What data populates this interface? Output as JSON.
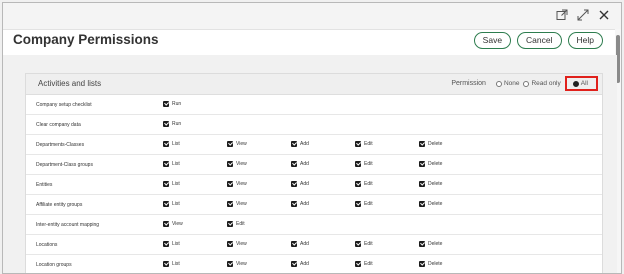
{
  "window": {
    "icons": [
      "open-in-new-icon",
      "expand-icon",
      "close-icon"
    ]
  },
  "header": {
    "title": "Company Permissions",
    "buttons": {
      "save": "Save",
      "cancel": "Cancel",
      "help": "Help"
    }
  },
  "section": {
    "title": "Activities and lists",
    "permission_label": "Permission",
    "options": {
      "none": "None",
      "readonly": "Read only",
      "all": "All"
    },
    "selected": "All"
  },
  "rows": [
    {
      "label": "Company setup checklist",
      "perms": [
        "Run"
      ]
    },
    {
      "label": "Clear company data",
      "perms": [
        "Run"
      ]
    },
    {
      "label": "Departments-Classes",
      "perms": [
        "List",
        "View",
        "Add",
        "Edit",
        "Delete"
      ]
    },
    {
      "label": "Department-Class groups",
      "perms": [
        "List",
        "View",
        "Add",
        "Edit",
        "Delete"
      ]
    },
    {
      "label": "Entities",
      "perms": [
        "List",
        "View",
        "Add",
        "Edit",
        "Delete"
      ]
    },
    {
      "label": "Affiliate entity groups",
      "perms": [
        "List",
        "View",
        "Add",
        "Edit",
        "Delete"
      ]
    },
    {
      "label": "Inter-entity account mapping",
      "perms": [
        "View",
        "Edit"
      ]
    },
    {
      "label": "Locations",
      "perms": [
        "List",
        "View",
        "Add",
        "Edit",
        "Delete"
      ]
    },
    {
      "label": "Location groups",
      "perms": [
        "List",
        "View",
        "Add",
        "Edit",
        "Delete"
      ]
    }
  ],
  "colors": {
    "accent": "#2e7d4f",
    "highlight": "#e0201b"
  }
}
